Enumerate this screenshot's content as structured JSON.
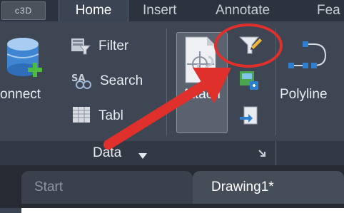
{
  "app_button": {
    "label": "c3D"
  },
  "tabs": [
    {
      "label": "Home",
      "active": true
    },
    {
      "label": "Insert",
      "active": false
    },
    {
      "label": "Annotate",
      "active": false
    },
    {
      "label": "Fea",
      "active": false
    }
  ],
  "ribbon": {
    "connect_label": "onnect",
    "filter_label": "Filter",
    "search_label": "Search",
    "table_label": "Tabl",
    "attach_label": "Attach",
    "polyline_label": "Polyline",
    "panel_title": "Data"
  },
  "doc_tabs": [
    {
      "label": "Start"
    },
    {
      "label": "Drawing1*"
    }
  ],
  "colors": {
    "annotation": "#e0302b",
    "ribbon_bg": "#3e4654",
    "accent_blue": "#2f7fd1"
  }
}
